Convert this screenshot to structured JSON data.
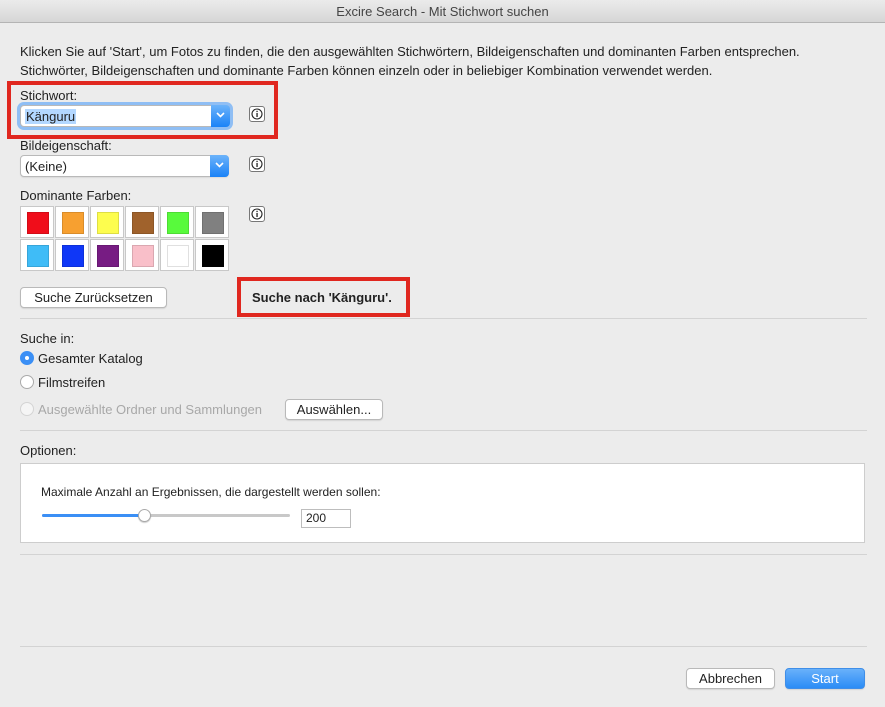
{
  "window": {
    "title": "Excire Search - Mit Stichwort suchen"
  },
  "intro": {
    "line1": "Klicken Sie auf 'Start', um Fotos zu finden, die den ausgewählten Stichwörtern, Bildeigenschaften und dominanten Farben entsprechen.",
    "line2": "Stichwörter, Bildeigenschaften und dominante Farben können einzeln oder in beliebiger Kombination verwendet werden."
  },
  "keyword": {
    "label": "Stichwort:",
    "value": "Känguru"
  },
  "property": {
    "label": "Bildeigenschaft:",
    "value": "(Keine)"
  },
  "colors": {
    "label": "Dominante Farben:",
    "swatches": [
      "#f00d1a",
      "#f7a030",
      "#fdfd4e",
      "#a0622c",
      "#58fa3c",
      "#808080",
      "#3fbcf7",
      "#0f37f7",
      "#771c83",
      "#f9bfc9",
      "#ffffff",
      "#000000"
    ]
  },
  "reset_button": "Suche Zurücksetzen",
  "search_summary": "Suche nach 'Känguru'.",
  "search_in": {
    "label": "Suche in:",
    "options": [
      {
        "label": "Gesamter Katalog",
        "selected": true,
        "enabled": true
      },
      {
        "label": "Filmstreifen",
        "selected": false,
        "enabled": true
      },
      {
        "label": "Ausgewählte Ordner und Sammlungen",
        "selected": false,
        "enabled": false
      }
    ],
    "choose_button": "Auswählen..."
  },
  "options": {
    "label": "Optionen:",
    "max_results_label": "Maximale Anzahl an Ergebnissen, die dargestellt werden sollen:",
    "max_results_value": "200",
    "slider_fraction": 0.41
  },
  "footer": {
    "cancel": "Abbrechen",
    "start": "Start"
  },
  "accent": "#3b8ff5",
  "highlight_color": "#e0271f"
}
